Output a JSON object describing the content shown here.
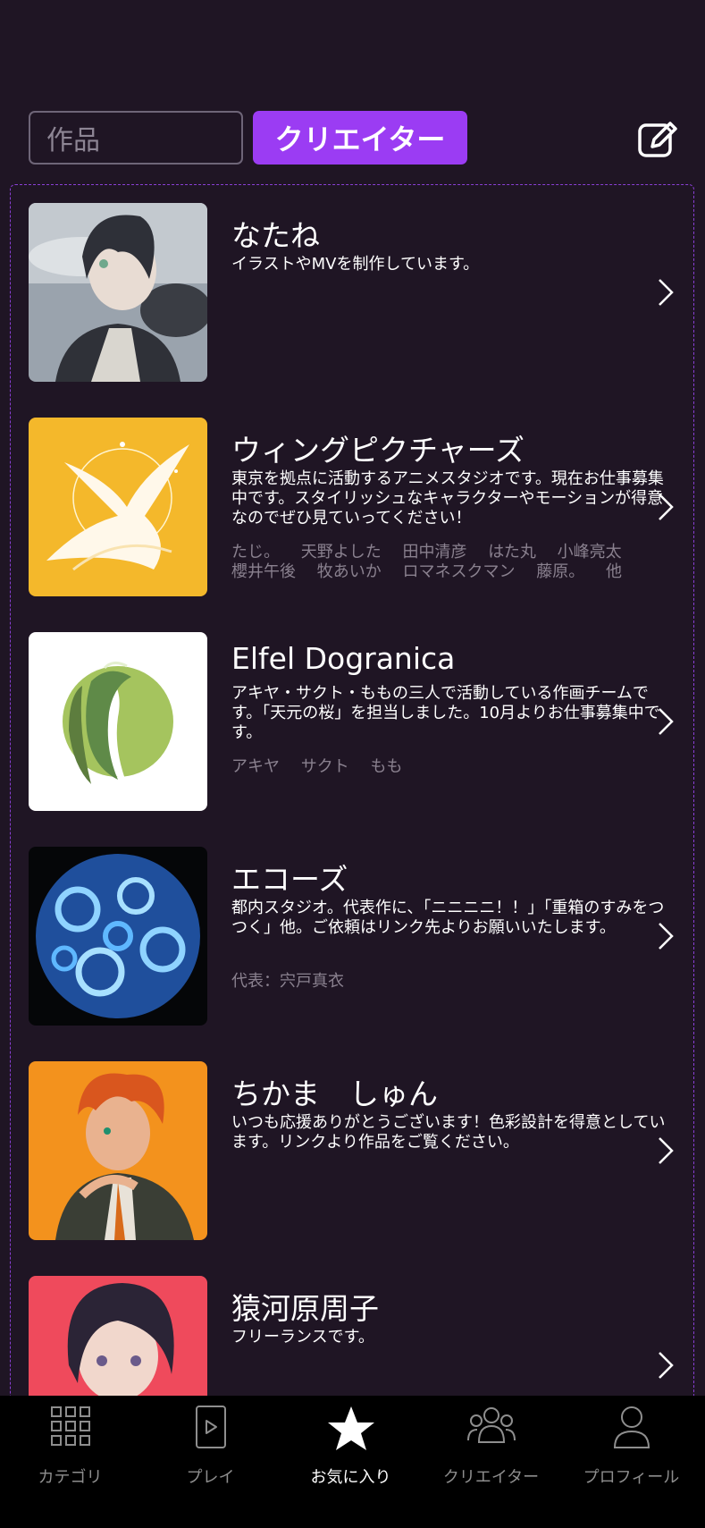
{
  "tabs": {
    "works_label": "作品",
    "creators_label": "クリエイター",
    "active": "creators"
  },
  "icons": {
    "edit": "edit-icon",
    "chevron": "chevron-right-icon"
  },
  "colors": {
    "accent": "#9b3cf3",
    "background": "#1f1524",
    "nav_background": "#000000"
  },
  "creators": [
    {
      "name": "なたね",
      "description": "イラストやMVを制作しています。",
      "members": []
    },
    {
      "name": "ウィングピクチャーズ",
      "description": "東京を拠点に活動するアニメスタジオです。現在お仕事募集中です。スタイリッシュなキャラクターやモーションが得意なのでぜひ見ていってください！",
      "members": [
        "たじ。",
        "天野よした",
        "田中清彦",
        "はた丸",
        "小峰亮太",
        "櫻井午後",
        "牧あいか",
        "ロマネスクマン",
        "藤原。",
        "他"
      ]
    },
    {
      "name": "Elfel Dogranica",
      "description": "アキヤ・サクト・ももの三人で活動している作画チームです。「天元の桜」を担当しました。10月よりお仕事募集中です。",
      "members": [
        "アキヤ",
        "サクト",
        "もも"
      ]
    },
    {
      "name": "エコーズ",
      "description": "都内スタジオ。代表作に、「ニニニニ！！」「重箱のすみをつつく」他。ご依頼はリンク先よりお願いいたします。",
      "members": [
        "代表：宍戸真衣"
      ]
    },
    {
      "name": "ちかま　しゅん",
      "description": "いつも応援ありがとうございます！色彩設計を得意としています。リンクより作品をご覧ください。",
      "members": []
    },
    {
      "name": "猿河原周子",
      "description": "フリーランスです。",
      "members": []
    }
  ],
  "nav": [
    {
      "label": "カテゴリ",
      "icon": "grid-icon",
      "active": false
    },
    {
      "label": "プレイ",
      "icon": "play-icon",
      "active": false
    },
    {
      "label": "お気に入り",
      "icon": "star-icon",
      "active": true
    },
    {
      "label": "クリエイター",
      "icon": "people-icon",
      "active": false
    },
    {
      "label": "プロフィール",
      "icon": "person-icon",
      "active": false
    }
  ]
}
